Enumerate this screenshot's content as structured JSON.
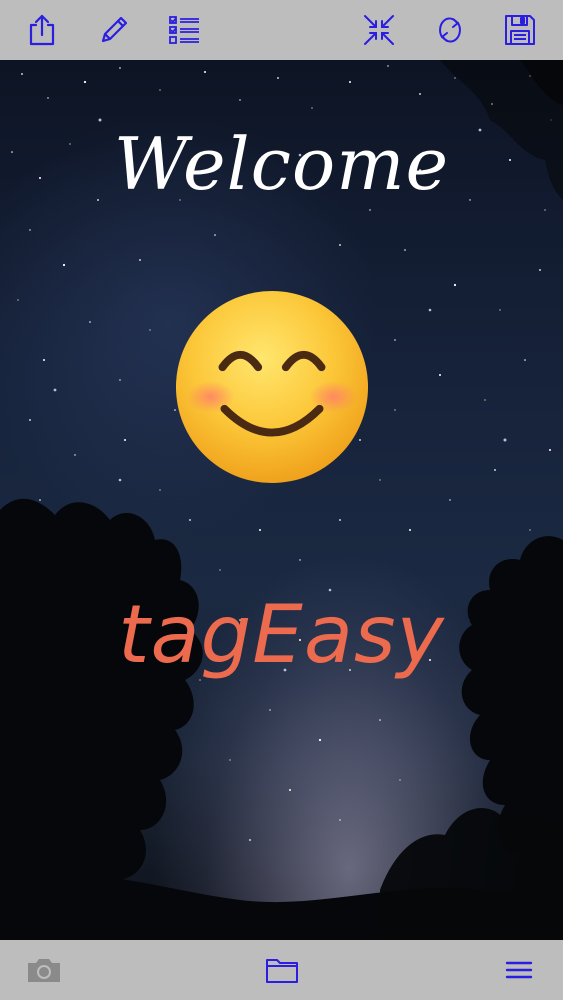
{
  "app": {
    "welcome_text": "Welcome",
    "brand_name": "tagEasy",
    "emoji": "smiling-face-with-smiling-eyes"
  },
  "top_toolbar": {
    "icons": [
      "share-icon",
      "pencil-icon",
      "checklist-icon",
      "collapse-icon",
      "refresh-icon",
      "save-icon"
    ]
  },
  "bottom_toolbar": {
    "icons": [
      "camera-icon",
      "folder-icon",
      "menu-icon"
    ]
  },
  "colors": {
    "toolbar_bg": "#bdbdbd",
    "icon_blue": "#2b1ee0",
    "brand_orange": "#ec6a4e",
    "camera_disabled": "#8a8a8a"
  }
}
